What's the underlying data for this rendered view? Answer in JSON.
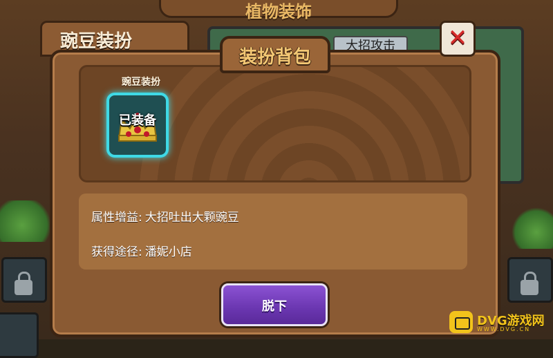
{
  "background": {
    "top_title": "植物装饰",
    "left_tab": "豌豆装扮",
    "right_chip": "大招攻击"
  },
  "dialog": {
    "title": "装扮背包",
    "close_symbol": "✕"
  },
  "outfit": {
    "label": "豌豆装扮",
    "status": "已装备",
    "icon": "crown-icon"
  },
  "info": {
    "attribute_key": "属性增益:",
    "attribute_value": "大招吐出大颗豌豆",
    "source_key": "获得途径:",
    "source_value": "潘妮小店"
  },
  "actions": {
    "unequip_label": "脱下"
  },
  "watermark": {
    "brand": "DVG游戏网",
    "url": "WWW.DVG.CN"
  },
  "colors": {
    "dialog_bg": "#8a5a33",
    "highlight": "#3fd9e6",
    "button_purple": "#6a36b0",
    "close_red": "#d62a2a"
  }
}
